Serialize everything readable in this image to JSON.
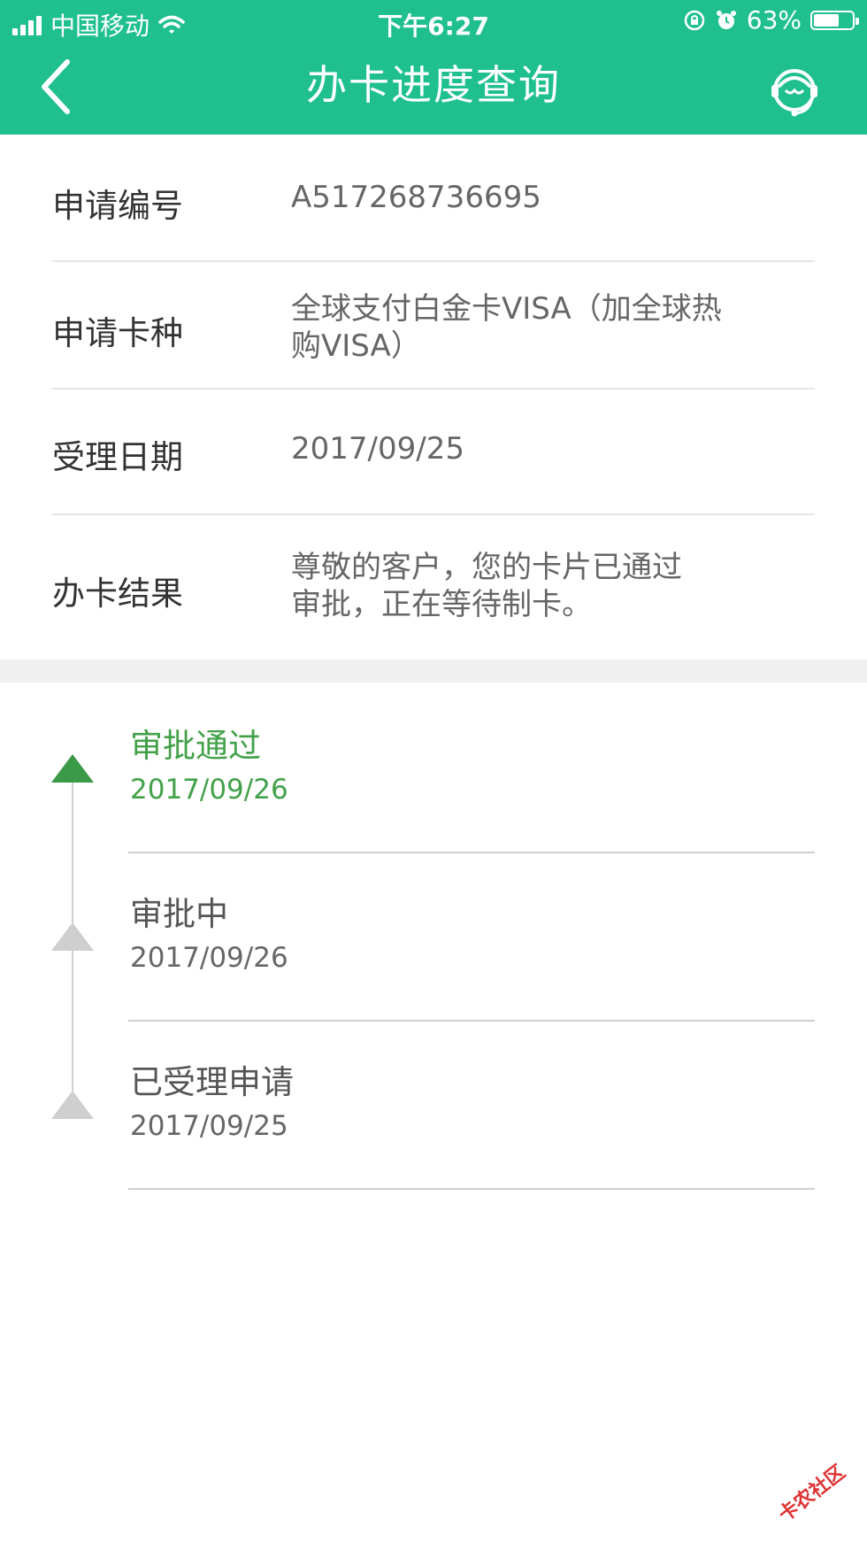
{
  "status_bar": {
    "carrier": "中国移动",
    "time": "下午6:27",
    "battery_percent": "63%"
  },
  "nav": {
    "title": "办卡进度查询",
    "back_icon": "chevron-left-icon",
    "service_icon": "customer-service-icon"
  },
  "info_rows": [
    {
      "label": "申请编号",
      "value": "A517268736695"
    },
    {
      "label": "申请卡种",
      "value_line1": "全球支付白金卡VISA（加全球热",
      "value_line2": "购VISA）"
    },
    {
      "label": "受理日期",
      "value": "2017/09/25"
    },
    {
      "label": "办卡结果",
      "value_line1": "尊敬的客户，您的卡片已通过",
      "value_line2": "审批，正在等待制卡。"
    }
  ],
  "timeline": [
    {
      "status": "审批通过",
      "date": "2017/09/26",
      "active": true
    },
    {
      "status": "审批中",
      "date": "2017/09/26",
      "active": false
    },
    {
      "status": "已受理申请",
      "date": "2017/09/25",
      "active": false
    }
  ],
  "colors": {
    "header_bg": "#1fc08e",
    "active_green": "#43a14a",
    "inactive_gray": "#cfcfcf"
  },
  "watermark": "卡农社区"
}
